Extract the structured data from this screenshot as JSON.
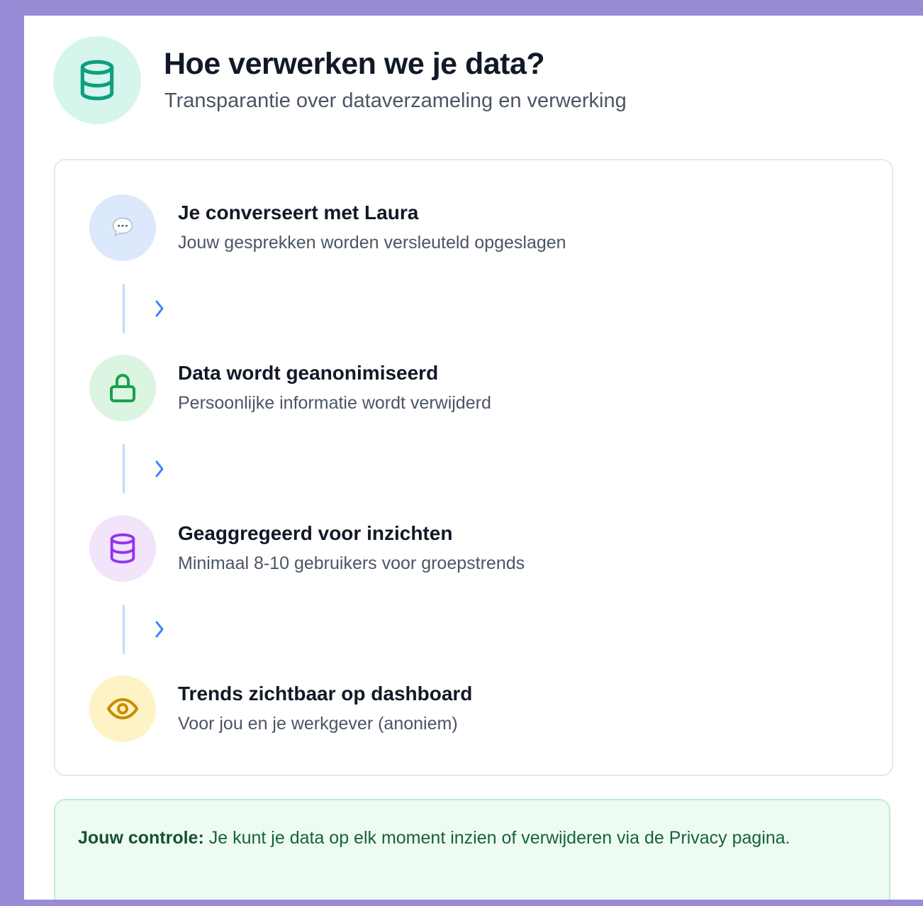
{
  "header": {
    "icon": "database-icon",
    "title": "Hoe verwerken we je data?",
    "subtitle": "Transparantie over dataverzameling en verwerking"
  },
  "steps": [
    {
      "icon": "chat-bubble-icon",
      "title": "Je converseert met Laura",
      "description": "Jouw gesprekken worden versleuteld opgeslagen",
      "icon_bg": "#dce8fb"
    },
    {
      "icon": "lock-icon",
      "title": "Data wordt geanonimiseerd",
      "description": "Persoonlijke informatie wordt verwijderd",
      "icon_bg": "#dcf5e3",
      "icon_color": "#16a34a"
    },
    {
      "icon": "database-icon",
      "title": "Geaggregeerd voor inzichten",
      "description": "Minimaal 8-10 gebruikers voor groepstrends",
      "icon_bg": "#f1e4fb",
      "icon_color": "#9333ea"
    },
    {
      "icon": "eye-icon",
      "title": "Trends zichtbaar op dashboard",
      "description": "Voor jou en je werkgever (anoniem)",
      "icon_bg": "#fdf3c4",
      "icon_color": "#ca8a04"
    }
  ],
  "connector_icon": "chevron-right-icon",
  "notice": {
    "label": "Jouw controle:",
    "text": " Je kunt je data op elk moment inzien of verwijderen via de Privacy pagina."
  },
  "colors": {
    "accent_teal": "#0f9f7f",
    "connector_blue": "#3b82f6",
    "background_border": "#9a8bd6"
  }
}
